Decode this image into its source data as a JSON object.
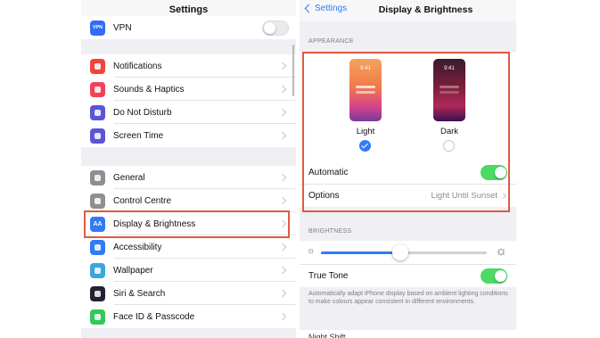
{
  "left": {
    "title": "Settings",
    "vpn": {
      "label": "VPN",
      "icon": "vpn-icon",
      "icon_text": "VPN",
      "color": "#2f6df6"
    },
    "group1": [
      {
        "label": "Notifications",
        "icon": "notifications-icon",
        "color": "#f0453a"
      },
      {
        "label": "Sounds & Haptics",
        "icon": "sounds-icon",
        "color": "#f0435a"
      },
      {
        "label": "Do Not Disturb",
        "icon": "moon-icon",
        "color": "#5b55d6"
      },
      {
        "label": "Screen Time",
        "icon": "hourglass-icon",
        "color": "#5b55d6"
      }
    ],
    "group2": [
      {
        "label": "General",
        "icon": "gear-icon",
        "color": "#8e8e93"
      },
      {
        "label": "Control Centre",
        "icon": "control-centre-icon",
        "color": "#8e8e93"
      },
      {
        "label": "Display & Brightness",
        "icon": "display-brightness-icon",
        "icon_text": "AA",
        "color": "#2f7cf6"
      },
      {
        "label": "Accessibility",
        "icon": "accessibility-icon",
        "color": "#2f7cf6"
      },
      {
        "label": "Wallpaper",
        "icon": "wallpaper-icon",
        "color": "#3aa6e0"
      },
      {
        "label": "Siri & Search",
        "icon": "siri-icon",
        "color": "#222233"
      },
      {
        "label": "Face ID & Passcode",
        "icon": "face-id-icon",
        "color": "#34c759"
      }
    ]
  },
  "right": {
    "back_label": "Settings",
    "title": "Display & Brightness",
    "appearance_header": "APPEARANCE",
    "light_label": "Light",
    "dark_label": "Dark",
    "phone_time": "9:41",
    "automatic_label": "Automatic",
    "options_label": "Options",
    "options_value": "Light Until Sunset",
    "brightness_header": "BRIGHTNESS",
    "brightness_level": 0.48,
    "true_tone_label": "True Tone",
    "true_tone_footer": "Automatically adapt iPhone display based on ambient lighting conditions to make colours appear consistent in different environments.",
    "peek_label": "Night Shift"
  },
  "colors": {
    "accent": "#2f7cf6",
    "toggle_on": "#4cd964",
    "highlight": "#e05a3c"
  }
}
